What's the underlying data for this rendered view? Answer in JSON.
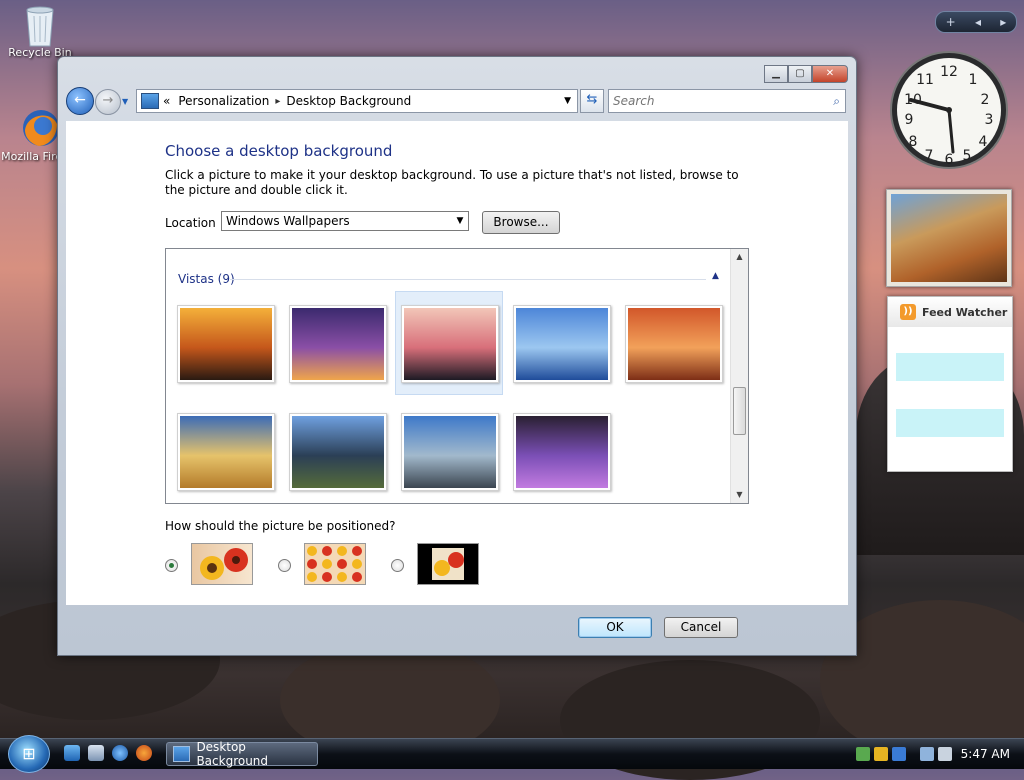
{
  "desktop": {
    "icons": [
      {
        "label": "Recycle Bin",
        "icon": "recycle-bin-icon"
      },
      {
        "label": "Mozilla Firefox",
        "icon": "firefox-icon"
      }
    ],
    "gadgets": {
      "feed_title": "Feed Watcher",
      "bar_add": "+",
      "bar_prev": "◂",
      "bar_next": "▸"
    }
  },
  "window": {
    "controls": {
      "minimize": "▁",
      "maximize": "▢",
      "close": "✕"
    },
    "nav": {
      "back": "←",
      "forward": "→",
      "breadcrumb_chevrons": "«",
      "breadcrumb": [
        "Personalization",
        "Desktop Background"
      ],
      "breadcrumb_separator": "▸",
      "search_placeholder": "Search"
    },
    "title": "Choose a desktop background",
    "description": "Click a picture to make it your desktop background. To use a picture that's not listed, browse to the picture and double click it.",
    "location_label": "Location",
    "location_value": "Windows Wallpapers",
    "browse_label": "Browse...",
    "group_label": "Vistas (9)",
    "thumbnails": [
      {
        "name": "vista-sunset-rocks",
        "colors": [
          "#f4b03a",
          "#c5571b",
          "#2a1a12"
        ]
      },
      {
        "name": "vista-city-bridge",
        "colors": [
          "#3b2a6e",
          "#8a4fa6",
          "#f0a54b"
        ]
      },
      {
        "name": "vista-ocean-sunset",
        "colors": [
          "#f2c6b8",
          "#d86f7a",
          "#1d1a24"
        ],
        "selected": true
      },
      {
        "name": "vista-blue-clouds",
        "colors": [
          "#4d86d8",
          "#9cc7f0",
          "#1f4c9a"
        ]
      },
      {
        "name": "vista-rock-arch",
        "colors": [
          "#d2572a",
          "#f2a15a",
          "#7d2e16"
        ]
      },
      {
        "name": "vista-golden-field",
        "colors": [
          "#3c6cb6",
          "#e6c36b",
          "#b47b2a"
        ]
      },
      {
        "name": "vista-mountain-lake",
        "colors": [
          "#6fa0e0",
          "#2b3f56",
          "#556b3a"
        ]
      },
      {
        "name": "vista-cliffs",
        "colors": [
          "#3e79c9",
          "#a2b9cc",
          "#3b4550"
        ]
      },
      {
        "name": "vista-aurora",
        "colors": [
          "#2a2032",
          "#7b4fb6",
          "#c27be0"
        ]
      }
    ],
    "position_question": "How should the picture be positioned?",
    "position_options": [
      {
        "name": "fit",
        "selected": true
      },
      {
        "name": "tile",
        "selected": false
      },
      {
        "name": "center",
        "selected": false
      }
    ],
    "ok_label": "OK",
    "cancel_label": "Cancel"
  },
  "taskbar": {
    "start": "⊞",
    "task": "Desktop Background",
    "time": "5:47 AM"
  }
}
